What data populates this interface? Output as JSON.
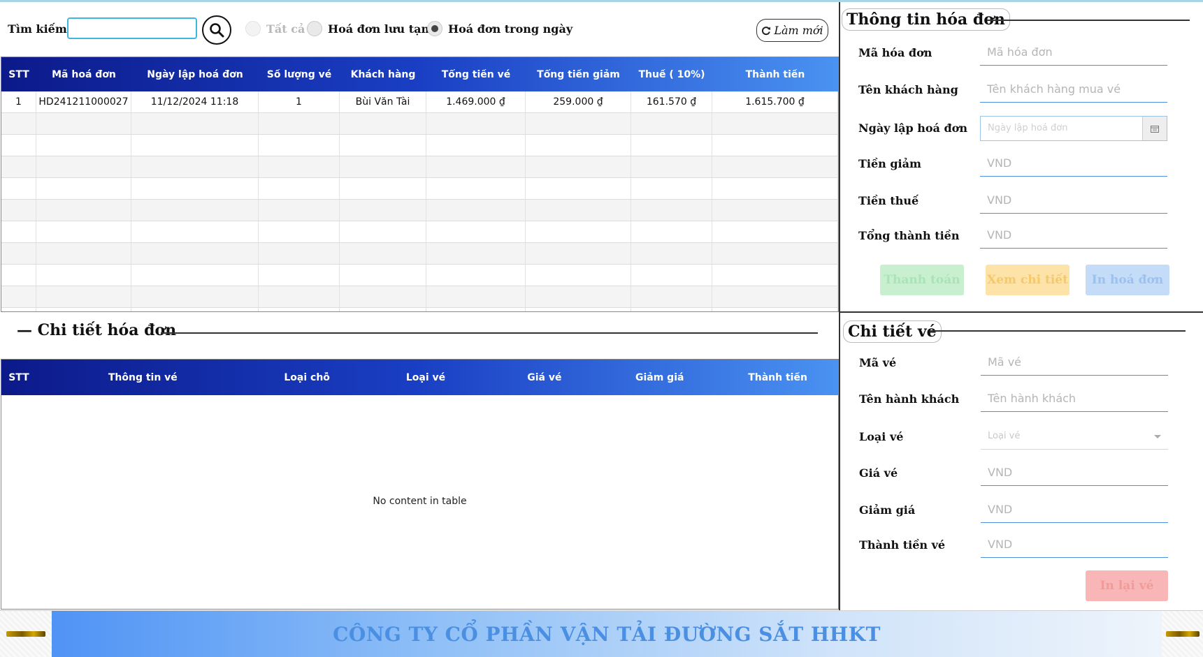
{
  "toolbar": {
    "search_label": "Tìm kiếm",
    "search_value": "",
    "radio_all": "Tất cả",
    "radio_temp": "Hoá đơn lưu tạm",
    "radio_today": "Hoá đơn trong ngày",
    "selected_radio": "Hoá đơn trong ngày",
    "refresh_label": "Làm mới"
  },
  "invoice_table": {
    "columns": [
      "STT",
      "Mã hoá đơn",
      "Ngày lập hoá đơn",
      "Số lượng vé",
      "Khách hàng",
      "Tổng tiền vé",
      "Tổng tiền giảm",
      "Thuế ( 10%)",
      "Thành tiền"
    ],
    "rows": [
      [
        "1",
        "HD241211000027",
        "11/12/2024 11:18",
        "1",
        "Bùi Văn Tài",
        "1.469.000 ₫",
        "259.000 ₫",
        "161.570 ₫",
        "1.615.700 ₫"
      ]
    ]
  },
  "invoice_detail": {
    "title": "— Chi tiết hóa đơn",
    "columns": [
      "STT",
      "Thông tin vé",
      "Loại chỗ",
      "Loại vé",
      "Giá vé",
      "Giảm giá",
      "Thành tiền"
    ],
    "empty_message": "No content in table"
  },
  "invoice_info": {
    "title": "Thông tin hóa đơn",
    "fields": [
      {
        "label": "Mã hóa đơn",
        "placeholder": "Mã hóa đơn"
      },
      {
        "label": "Tên khách hàng",
        "placeholder": "Tên khách hàng mua vé"
      },
      {
        "label": "Ngày lập hoá đơn",
        "placeholder": "Ngày lập hoá đơn"
      },
      {
        "label": "Tiền giảm",
        "placeholder": "VND"
      },
      {
        "label": "Tiền thuế",
        "placeholder": "VND"
      },
      {
        "label": "Tổng thành tiền",
        "placeholder": "VND"
      }
    ],
    "buttons": {
      "pay": "Thanh toán",
      "view": "Xem chi tiết",
      "print": "In hoá đơn"
    },
    "button_colors": {
      "pay": "#c8f0d0",
      "view": "#fde3a7",
      "print": "#c4dcf7"
    }
  },
  "ticket_detail": {
    "title": "Chi tiết vé",
    "fields": [
      {
        "label": "Mã vé",
        "placeholder": "Mã vé"
      },
      {
        "label": "Tên hành khách",
        "placeholder": "Tên hành khách"
      },
      {
        "label": "Loại vé",
        "placeholder": "Loại vé"
      },
      {
        "label": "Giá vé",
        "placeholder": "VND"
      },
      {
        "label": "Giảm giá",
        "placeholder": "VND"
      },
      {
        "label": "Thành tiền vé",
        "placeholder": "VND"
      }
    ],
    "reprint": "In lại vé",
    "reprint_color": "#f9b6b6"
  },
  "footer": {
    "company": "CÔNG TY CỔ PHẦN VẬN TẢI ĐƯỜNG SẮT HHKT"
  },
  "colors": {
    "header_gradient_start": "#0c1a8a",
    "header_gradient_end": "#4a92f2",
    "accent": "#4a8fd8"
  }
}
